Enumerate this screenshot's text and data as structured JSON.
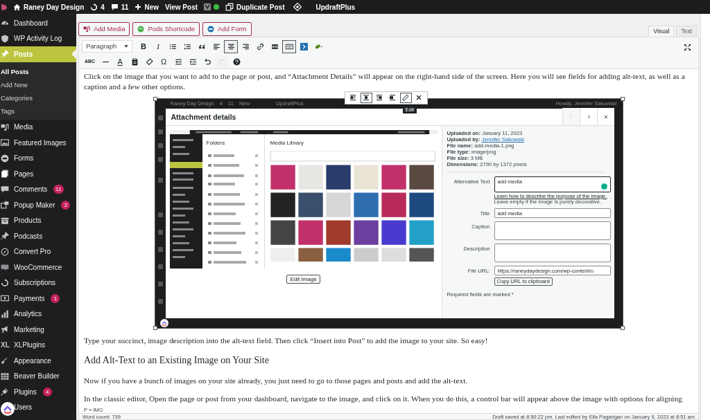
{
  "admin_bar": {
    "site": "Raney Day Design",
    "updates": "4",
    "comments": "11",
    "new": "New",
    "view_post": "View Post",
    "duplicate": "Duplicate Post",
    "updraft": "UpdraftPlus"
  },
  "sidebar": {
    "items": [
      {
        "label": "Dashboard",
        "selected": false
      },
      {
        "label": "WP Activity Log",
        "selected": false
      },
      {
        "label": "Posts",
        "selected": true,
        "children": [
          {
            "label": "All Posts",
            "selected": true
          },
          {
            "label": "Add New",
            "selected": false
          },
          {
            "label": "Categories",
            "selected": false
          },
          {
            "label": "Tags",
            "selected": false
          }
        ]
      },
      {
        "label": "Media",
        "selected": false
      },
      {
        "label": "Featured Images",
        "selected": false
      },
      {
        "label": "Forms",
        "selected": false
      },
      {
        "label": "Pages",
        "selected": false
      },
      {
        "label": "Comments",
        "selected": false,
        "badge": "11"
      },
      {
        "label": "Popup Maker",
        "selected": false,
        "badge": "2"
      },
      {
        "label": "Products",
        "selected": false
      },
      {
        "label": "Podcasts",
        "selected": false
      },
      {
        "label": "Convert Pro",
        "selected": false
      },
      {
        "label": "WooCommerce",
        "selected": false
      },
      {
        "label": "Subscriptions",
        "selected": false
      },
      {
        "label": "Payments",
        "selected": false,
        "badge": "1"
      },
      {
        "label": "Analytics",
        "selected": false
      },
      {
        "label": "Marketing",
        "selected": false
      },
      {
        "label": "XLPlugins",
        "selected": false,
        "icon_text": "XL"
      },
      {
        "label": "Appearance",
        "selected": false
      },
      {
        "label": "Beaver Builder",
        "selected": false
      },
      {
        "label": "Plugins",
        "selected": false,
        "badge": "4"
      },
      {
        "label": "Users",
        "selected": false
      }
    ]
  },
  "media_buttons": [
    "Add Media",
    "Pods Shortcode",
    "Add Form"
  ],
  "editor_tabs": [
    {
      "label": "Visual",
      "selected": true
    },
    {
      "label": "Text",
      "selected": false
    }
  ],
  "toolbar": {
    "rows": [
      [
        {
          "kind": "select",
          "text": "Paragraph"
        },
        {
          "kind": "glyph",
          "text": "B",
          "active": false,
          "disabled": false
        },
        {
          "kind": "glyph",
          "text": "I",
          "active": false,
          "disabled": false
        },
        {
          "kind": "icon",
          "active": false,
          "disabled": false
        },
        {
          "kind": "icon",
          "active": false,
          "disabled": false
        },
        {
          "kind": "icon",
          "active": false,
          "disabled": false
        },
        {
          "kind": "icon",
          "active": false,
          "disabled": false
        },
        {
          "kind": "icon",
          "active": true,
          "disabled": false
        },
        {
          "kind": "icon",
          "active": false,
          "disabled": false
        },
        {
          "kind": "icon",
          "active": false,
          "disabled": false
        },
        {
          "kind": "icon",
          "active": false,
          "disabled": false
        },
        {
          "kind": "icon",
          "active": true,
          "disabled": false
        },
        {
          "kind": "icon",
          "active": false,
          "disabled": false
        },
        {
          "kind": "icon",
          "active": false,
          "disabled": false
        }
      ],
      [
        {
          "kind": "glyph",
          "text": "ABC",
          "active": false,
          "disabled": false
        },
        {
          "kind": "icon",
          "active": false,
          "disabled": false
        },
        {
          "kind": "glyph",
          "text": "A",
          "active": false,
          "disabled": false
        },
        {
          "kind": "icon",
          "active": false,
          "disabled": false
        },
        {
          "kind": "icon",
          "active": false,
          "disabled": false
        },
        {
          "kind": "glyph",
          "text": "Ω",
          "active": false,
          "disabled": false
        },
        {
          "kind": "icon",
          "active": false,
          "disabled": false
        },
        {
          "kind": "icon",
          "active": false,
          "disabled": false
        },
        {
          "kind": "icon",
          "active": false,
          "disabled": false
        },
        {
          "kind": "icon",
          "active": false,
          "disabled": true
        },
        {
          "kind": "icon",
          "active": false,
          "disabled": false
        }
      ]
    ]
  },
  "content": {
    "intro": "Click on the image that you want to add to the page or post, and “Attachment Details” will appear on the right-hand side of the screen. Here you will see fields for adding alt-text, as well as a caption and a few other options.",
    "image": {
      "selected": true,
      "toolbar": [
        {
          "active": false
        },
        {
          "active": true
        },
        {
          "active": false
        },
        {
          "active": false
        },
        {
          "active": true
        },
        {
          "active": false
        }
      ],
      "tooltip": "Edit",
      "screenshot": {
        "admin_bar": {
          "site": "Raney Day Design",
          "updates": "4",
          "comments": "11",
          "new": "New",
          "updraft": "UpdraftPlus",
          "greeting": "Howdy, Jennifer Sakowski"
        },
        "modal_title": "Attachment details",
        "nav": [
          {
            "disabled": true
          },
          {
            "disabled": false
          },
          {
            "disabled": false
          }
        ],
        "folders_title": "Folders",
        "library_title": "Media Library",
        "edit_button": "Edit Image",
        "details": [
          {
            "text": "**Uploaded on:** January 11, 2023"
          },
          {
            "text": "**Uploaded by:**",
            "link": "Jennifer Sakowski"
          },
          {
            "text": "**File name:** add-media-1.png"
          },
          {
            "text": "**File type:** image/png"
          },
          {
            "text": "**File size:** 3 MB"
          },
          {
            "text": "**Dimensions:** 2790 by 1372 pixels"
          }
        ],
        "fields": [
          {
            "label": "Alternative Text",
            "value": "add media",
            "kind": "textarea",
            "focused": true
          },
          {
            "label": "Title",
            "value": "add media",
            "kind": "input",
            "focused": false
          },
          {
            "label": "Caption",
            "kind": "textarea",
            "focused": false
          },
          {
            "label": "Description",
            "kind": "textarea",
            "focused": false
          },
          {
            "label": "File URL:",
            "value": "https://raneydaydesign.com/wp-content/u",
            "kind": "input",
            "focused": false
          }
        ],
        "alt_help_link": "Learn how to describe the purpose of the image.",
        "alt_help": "Leave empty if the image is purely decorative.",
        "copy_button": "Copy URL to clipboard",
        "required_note": "Required fields are marked *"
      }
    },
    "after_image": "Type your succinct, image description into the alt-text field. Then click “Insert into Post” to add the image to your site. So easy!",
    "heading": "Add Alt-Text to an Existing Image on Your Site",
    "paragraphs": [
      "Now if you have a bunch of images on your site already, you just need to go to those pages and posts and add the alt-text.",
      "In the classic editor, Open the page or post from your dashboard, navigate to the image, and click on it. When you do this, a control bar will appear above the image with options for aligning"
    ]
  },
  "status": {
    "path": "P » IMG",
    "word_count": "Word count: 739",
    "draft": "Draft saved at 8:50:22 pm. Last edited by Ella Pagarigan on January 9, 2023 at 8:51 am"
  }
}
